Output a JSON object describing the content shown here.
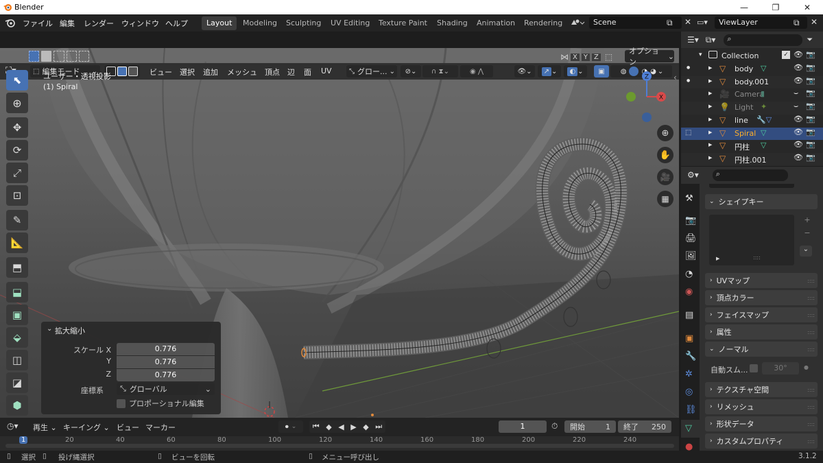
{
  "window": {
    "title": "Blender",
    "min": "—",
    "max": "❐",
    "close": "✕"
  },
  "menu": {
    "items": [
      "ファイル",
      "編集",
      "レンダー",
      "ウィンドウ",
      "ヘルプ"
    ],
    "workspaces": [
      "Layout",
      "Modeling",
      "Sculpting",
      "UV Editing",
      "Texture Paint",
      "Shading",
      "Animation",
      "Rendering"
    ],
    "active_workspace": "Layout",
    "scene": "Scene",
    "view_layer": "ViewLayer"
  },
  "viewport_header": {
    "mode": "編集モード",
    "menus": [
      "ビュー",
      "選択",
      "追加",
      "メッシュ",
      "頂点",
      "辺",
      "面",
      "UV"
    ],
    "transform_orientation": "グロー...",
    "axis_x": "X",
    "axis_y": "Y",
    "axis_z": "Z",
    "options": "オプション"
  },
  "viewport": {
    "view_label": "ユーザー・透視投影",
    "object_label": "(1) Spiral",
    "gizmo_x": "X",
    "gizmo_z": "Z"
  },
  "operator_panel": {
    "title": "拡大縮小",
    "scale_label": "スケール X",
    "y_label": "Y",
    "z_label": "Z",
    "scale_x": "0.776",
    "scale_y": "0.776",
    "scale_z": "0.776",
    "orientation_label": "座標系",
    "orientation_value": "グローバル",
    "proportional_label": "プロポーショナル編集",
    "proportional_checked": false
  },
  "outliner": {
    "collection": "Collection",
    "items": [
      {
        "name": "body"
      },
      {
        "name": "body.001"
      },
      {
        "name": "Camera"
      },
      {
        "name": "Light"
      },
      {
        "name": "line"
      },
      {
        "name": "Spiral"
      },
      {
        "name": "円柱"
      },
      {
        "name": "円柱.001"
      }
    ]
  },
  "properties": {
    "panels": [
      "シェイプキー",
      "UVマップ",
      "頂点カラー",
      "フェイスマップ",
      "属性",
      "ノーマル",
      "テクスチャ空間",
      "リメッシュ",
      "形状データ",
      "カスタムプロパティ"
    ],
    "auto_smooth_label": "自動スム...",
    "auto_smooth_angle": "30°",
    "plus": "+",
    "minus": "−",
    "grip": "::::"
  },
  "timeline": {
    "playback": "再生",
    "keying": "キーイング",
    "view": "ビュー",
    "marker": "マーカー",
    "current_frame": "1",
    "start_label": "開始",
    "start": "1",
    "end_label": "終了",
    "end": "250",
    "ruler": [
      "1",
      "20",
      "40",
      "60",
      "80",
      "100",
      "120",
      "140",
      "160",
      "180",
      "200",
      "220",
      "240"
    ]
  },
  "statusbar": {
    "select": "選択",
    "lasso": "投げ縄選択",
    "rotate": "ビューを回転",
    "menu": "メニュー呼び出し",
    "version": "3.1.2"
  },
  "colors": {
    "accent": "#4772b3",
    "selected_row": "#334d80",
    "object_orange": "#e08a3c",
    "mesh_green": "#4ecba0"
  }
}
